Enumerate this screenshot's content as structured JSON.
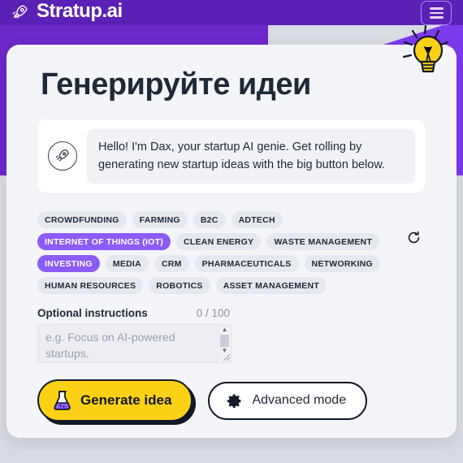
{
  "header": {
    "brand_name": "Stratup.ai",
    "brand_icon": "rocket-icon",
    "menu_icon": "hamburger-menu-icon",
    "bg_color": "#5b21b6"
  },
  "decor": {
    "bulb_icon": "lightbulb-icon",
    "bulb_color": "#fcd116",
    "band_color": "#6d28c9",
    "band_light_color": "#7c3aed",
    "orange_color": "#fbbf24"
  },
  "main": {
    "title": "Генерируйте идеи",
    "chat": {
      "avatar_icon": "rocket-avatar-icon",
      "message": "Hello! I'm Dax, your startup AI genie. Get rolling by generating new startup ideas with the big button below."
    },
    "tags": [
      {
        "label": "CROWDFUNDING",
        "selected": false
      },
      {
        "label": "FARMING",
        "selected": false
      },
      {
        "label": "B2C",
        "selected": false
      },
      {
        "label": "ADTECH",
        "selected": false
      },
      {
        "label": "INTERNET OF THINGS (IOT)",
        "selected": true
      },
      {
        "label": "CLEAN ENERGY",
        "selected": false
      },
      {
        "label": "WASTE MANAGEMENT",
        "selected": false
      },
      {
        "label": "INVESTING",
        "selected": true
      },
      {
        "label": "MEDIA",
        "selected": false
      },
      {
        "label": "CRM",
        "selected": false
      },
      {
        "label": "PHARMACEUTICALS",
        "selected": false
      },
      {
        "label": "NETWORKING",
        "selected": false
      },
      {
        "label": "HUMAN RESOURCES",
        "selected": false
      },
      {
        "label": "ROBOTICS",
        "selected": false
      },
      {
        "label": "ASSET MANAGEMENT",
        "selected": false
      }
    ],
    "selected_tag_color": "#8b5cf6",
    "refresh_icon": "refresh-icon",
    "instructions": {
      "label": "Optional instructions",
      "counter": "0 / 100",
      "placeholder": "e.g. Focus on AI-powered startups.",
      "value": ""
    },
    "buttons": {
      "generate": {
        "label": "Generate idea",
        "icon": "flask-icon",
        "bg_color": "#fcd116"
      },
      "advanced": {
        "label": "Advanced mode",
        "icon": "gear-icon",
        "bg_color": "#ffffff"
      }
    }
  }
}
